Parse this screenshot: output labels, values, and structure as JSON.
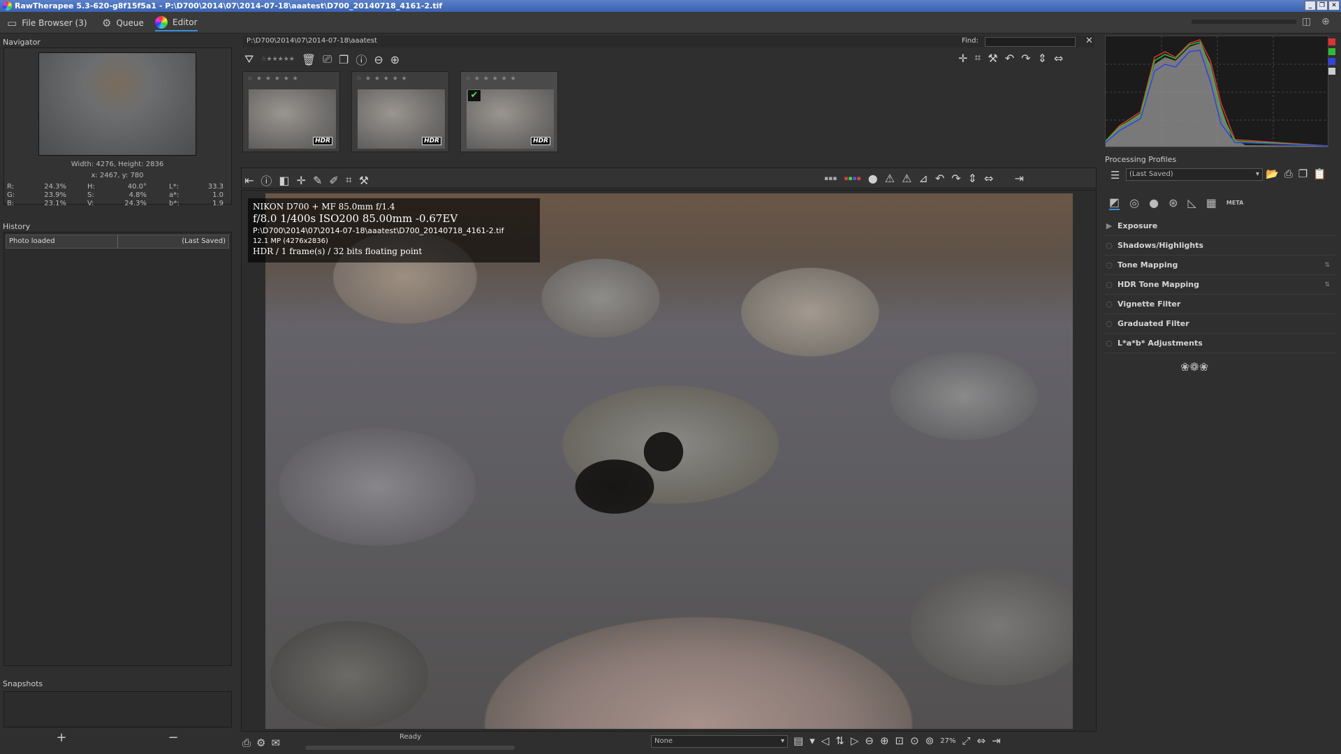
{
  "window": {
    "title": "RawTherapee 5.3-620-g8f15f5a1 - P:\\D700\\2014\\07\\2014-07-18\\aaatest\\D700_20140718_4161-2.tif",
    "buttons": {
      "minimize": "_",
      "maximize": "❐",
      "close": "✕"
    }
  },
  "tabs": {
    "file_browser": "File Browser (3)",
    "queue": "Queue",
    "editor": "Editor"
  },
  "navigator": {
    "label": "Navigator",
    "size": "Width: 4276, Height: 2836",
    "coords": "x: 2467, y: 780",
    "values": [
      {
        "k1": "R:",
        "v1": "24.3%",
        "k2": "H:",
        "v2": "40.0°",
        "k3": "L*:",
        "v3": "33.3"
      },
      {
        "k1": "G:",
        "v1": "23.9%",
        "k2": "S:",
        "v2": "4.8%",
        "k3": "a*:",
        "v3": "1.0"
      },
      {
        "k1": "B:",
        "v1": "23.1%",
        "k2": "V:",
        "v2": "24.3%",
        "k3": "b*:",
        "v3": "1.9"
      }
    ]
  },
  "history": {
    "label": "History",
    "entry": "Photo loaded",
    "entry_value": "(Last Saved)"
  },
  "snapshots": {
    "label": "Snapshots",
    "add": "+",
    "remove": "−"
  },
  "filebrowser": {
    "path": "P:\\D700\\2014\\07\\2014-07-18\\aaatest",
    "find_label": "Find:",
    "find_value": "",
    "thumbs": [
      {
        "badge": "HDR",
        "stars": "☆ ★ ★ ★ ★ ★",
        "selected": false
      },
      {
        "badge": "HDR",
        "stars": "☆ ★ ★ ★ ★ ★",
        "selected": false
      },
      {
        "badge": "HDR",
        "stars": "☆ ★ ★ ★ ★ ★",
        "selected": true
      }
    ]
  },
  "exif": {
    "line1": "NIKON D700 + MF 85.0mm f/1.4",
    "line2": "f/8.0  1/400s  ISO200  85.00mm  -0.67EV",
    "line3": "P:\\D700\\2014\\07\\2014-07-18\\aaatest\\D700_20140718_4161-2.tif",
    "line4": "12.1 MP (4276x2836)",
    "line5": "HDR / 1 frame(s) / 32 bits floating point"
  },
  "statusbar": {
    "ready": "Ready",
    "preset": "None",
    "zoom": "27%"
  },
  "profiles": {
    "label": "Processing Profiles",
    "value": "(Last Saved)"
  },
  "tools": {
    "meta_tab": "META",
    "items": [
      {
        "name": "Exposure",
        "bullet": "▶",
        "x": ""
      },
      {
        "name": "Shadows/Highlights",
        "bullet": "◌",
        "x": ""
      },
      {
        "name": "Tone Mapping",
        "bullet": "◌",
        "x": "⇅"
      },
      {
        "name": "HDR Tone Mapping",
        "bullet": "◌",
        "x": "⇅"
      },
      {
        "name": "Vignette Filter",
        "bullet": "◌",
        "x": ""
      },
      {
        "name": "Graduated Filter",
        "bullet": "◌",
        "x": ""
      },
      {
        "name": "L*a*b* Adjustments",
        "bullet": "◌",
        "x": ""
      }
    ],
    "ornament": "❀❁❀"
  },
  "colors": {
    "accent": "#3a8fd6",
    "titlebar": "#3a63b0"
  }
}
